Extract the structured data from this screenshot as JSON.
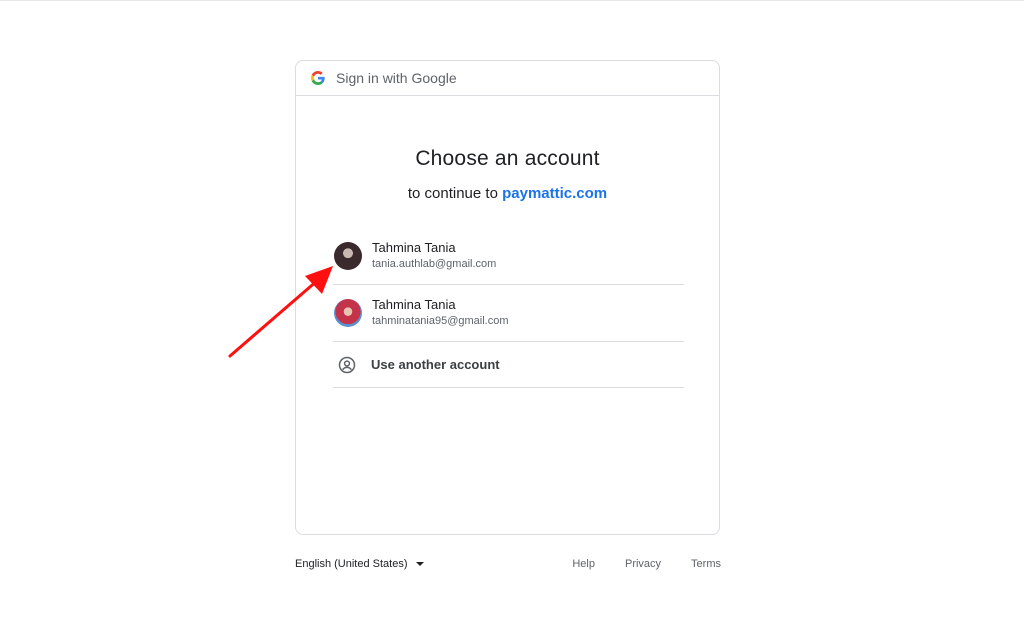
{
  "header": {
    "title": "Sign in with Google",
    "logo_icon": "google-g-icon"
  },
  "main": {
    "title": "Choose an account",
    "subtitle_prefix": "to continue to",
    "site": "paymattic.com"
  },
  "accounts": [
    {
      "name": "Tahmina Tania",
      "email": "tania.authlab@gmail.com"
    },
    {
      "name": "Tahmina Tania",
      "email": "tahminatania95@gmail.com"
    }
  ],
  "use_another": {
    "label": "Use another account",
    "icon": "person-circle-icon"
  },
  "footer": {
    "language": "English (United States)",
    "links": [
      "Help",
      "Privacy",
      "Terms"
    ]
  },
  "colors": {
    "accent": "#1a73e8",
    "annotation_arrow": "#ff0000",
    "border": "#dadce0"
  }
}
